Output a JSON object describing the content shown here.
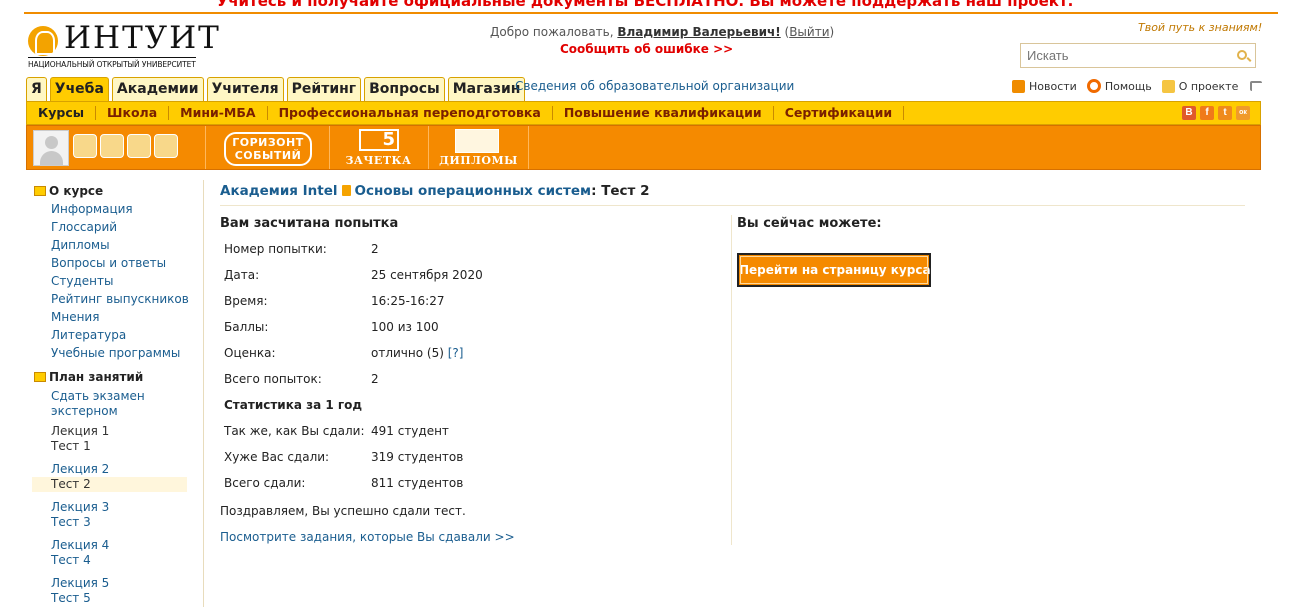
{
  "promo": "Учитесь и получайте официальные документы БЕСПЛАТНО. Вы можете поддержать наш проект.",
  "logo": {
    "word": "ИНТУИТ",
    "sub": "НАЦИОНАЛЬНЫЙ ОТКРЫТЫЙ УНИВЕРСИТЕТ"
  },
  "header": {
    "welcome_prefix": "Добро пожаловать, ",
    "user_name": "Владимир Валерьевич!",
    "logout_open": " (",
    "logout": "Выйти",
    "logout_close": ")",
    "report_error": "Сообщить об ошибке >>",
    "slogan": "Твой путь к знаниям!",
    "search_placeholder": "Искать"
  },
  "tabs": [
    "Я",
    "Учеба",
    "Академии",
    "Учителя",
    "Рейтинг",
    "Вопросы",
    "Магазин"
  ],
  "org_link": "Сведения об образовательной организации",
  "toplinks": {
    "news": "Новости",
    "help": "Помощь",
    "about": "О проекте"
  },
  "subnav": [
    "Курсы",
    "Школа",
    "Мини-МБА",
    "Профессиональная переподготовка",
    "Повышение квалификации",
    "Сертификации"
  ],
  "social": [
    {
      "label": "В",
      "color": "#e05a2b"
    },
    {
      "label": "f",
      "color": "#f07a1a"
    },
    {
      "label": "t",
      "color": "#ef8a1c"
    },
    {
      "label": "ок",
      "color": "#f09a2a"
    }
  ],
  "toolbar": {
    "horizon_line1": "ГОРИЗОНТ",
    "horizon_line2": "СОБЫТИЙ",
    "zachetka_num": "5",
    "zachetka": "ЗАЧЕТКА",
    "diplomy": "ДИПЛОМЫ"
  },
  "sidebar": {
    "about_title": "О курсе",
    "about_items": [
      "Информация",
      "Глоссарий",
      "Дипломы",
      "Вопросы и ответы",
      "Студенты",
      "Рейтинг выпускников",
      "Мнения",
      "Литература",
      "Учебные программы"
    ],
    "plan_title": "План занятий",
    "plan_first_l1": "Сдать экзамен",
    "plan_first_l2": "экстерном",
    "lectures": [
      {
        "lecture": "Лекция 1",
        "test": "Тест 1"
      },
      {
        "lecture": "Лекция 2",
        "test": "Тест 2"
      },
      {
        "lecture": "Лекция 3",
        "test": "Тест 3"
      },
      {
        "lecture": "Лекция 4",
        "test": "Тест 4"
      },
      {
        "lecture": "Лекция 5",
        "test": "Тест 5"
      }
    ]
  },
  "breadcrumb": {
    "academy": "Академия Intel",
    "course": "Основы операционных систем",
    "sep": ": ",
    "current": "Тест 2"
  },
  "result": {
    "title": "Вам засчитана попытка",
    "rows": [
      {
        "k": "Номер попытки:",
        "v": "2"
      },
      {
        "k": "Дата:",
        "v": "25 сентября 2020"
      },
      {
        "k": "Время:",
        "v": "16:25-16:27"
      },
      {
        "k": "Баллы:",
        "v": "100 из 100"
      },
      {
        "k": "Оценка:",
        "v": "отлично (5) ",
        "hint": "[?]"
      },
      {
        "k": "Всего попыток:",
        "v": "2"
      }
    ],
    "stats_title": "Статистика за 1 год",
    "stats": [
      {
        "k": "Так же, как Вы сдали:",
        "v": "491 студент"
      },
      {
        "k": "Хуже Вас сдали:",
        "v": "319 студентов"
      },
      {
        "k": "Всего сдали:",
        "v": "811 студентов"
      }
    ],
    "congrats": "Поздравляем, Вы успешно сдали тест.",
    "view_link": "Посмотрите задания, которые Вы сдавали >>"
  },
  "actions": {
    "title": "Вы сейчас можете:",
    "go_course": "Перейти на страницу курса"
  }
}
